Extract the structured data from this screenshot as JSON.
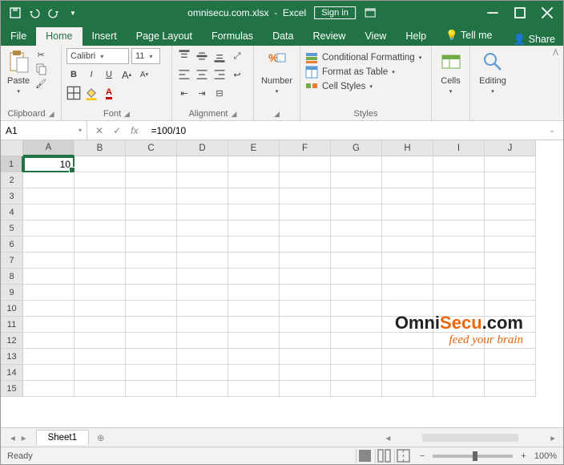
{
  "title": {
    "filename": "omnisecu.com.xlsx",
    "app": "Excel",
    "signin": "Sign in"
  },
  "tabs": {
    "file": "File",
    "home": "Home",
    "insert": "Insert",
    "pagelayout": "Page Layout",
    "formulas": "Formulas",
    "data": "Data",
    "review": "Review",
    "view": "View",
    "help": "Help",
    "tellme": "Tell me",
    "share": "Share"
  },
  "ribbon": {
    "clipboard": {
      "label": "Clipboard",
      "paste": "Paste"
    },
    "font": {
      "label": "Font",
      "name": "Calibri",
      "size": "11"
    },
    "alignment": {
      "label": "Alignment"
    },
    "number": {
      "label": "Number",
      "btn": "Number"
    },
    "styles": {
      "label": "Styles",
      "cond": "Conditional Formatting",
      "fmt": "Format as Table",
      "cell": "Cell Styles"
    },
    "cells": {
      "label": "Cells",
      "btn": "Cells"
    },
    "editing": {
      "label": "Editing",
      "btn": "Editing"
    }
  },
  "namebox": "A1",
  "formula": "=100/10",
  "grid": {
    "cols": [
      "A",
      "B",
      "C",
      "D",
      "E",
      "F",
      "G",
      "H",
      "I",
      "J"
    ],
    "rows": [
      "1",
      "2",
      "3",
      "4",
      "5",
      "6",
      "7",
      "8",
      "9",
      "10",
      "11",
      "12",
      "13",
      "14",
      "15"
    ],
    "a1": "10"
  },
  "sheets": {
    "sheet1": "Sheet1"
  },
  "status": {
    "ready": "Ready",
    "zoom": "100%"
  },
  "watermark": {
    "p1": "Omni",
    "p2": "Secu",
    "p3": ".com",
    "tag": "feed your brain"
  }
}
